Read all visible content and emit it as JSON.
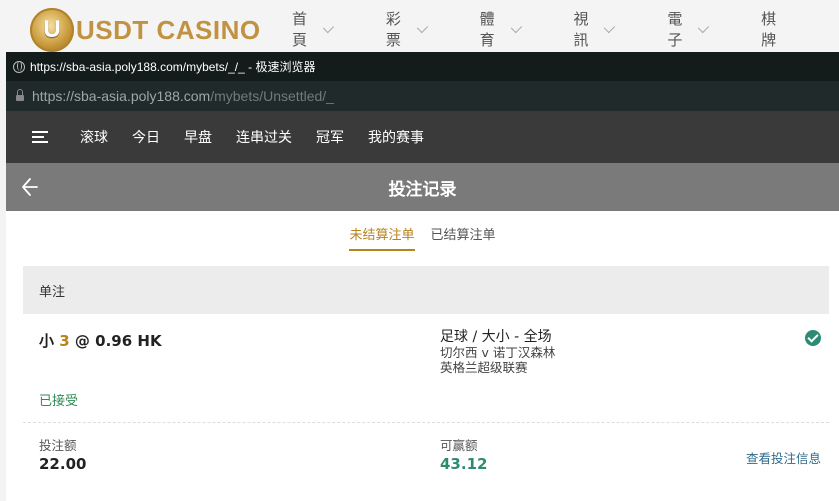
{
  "site": {
    "logo_letter": "U",
    "logo_text": "USDT CASINO",
    "nav": [
      "首頁",
      "彩票",
      "體育",
      "視訊",
      "電子",
      "棋牌"
    ]
  },
  "browser": {
    "title": "https://sba-asia.poly188.com/mybets/_/_ - 极速浏览器",
    "url_base": "https://sba-asia.poly188.com",
    "url_path": "/mybets/Unsettled/_"
  },
  "appnav": {
    "items": [
      "滚球",
      "今日",
      "早盘",
      "连串过关",
      "冠军",
      "我的赛事"
    ]
  },
  "page": {
    "title": "投注记录",
    "tabs": [
      {
        "label": "未结算注单",
        "active": true
      },
      {
        "label": "已结算注单",
        "active": false
      }
    ]
  },
  "bet": {
    "type": "单注",
    "selection": "小",
    "line": "3",
    "at": "@",
    "odds": "0.96 HK",
    "market": "足球 / 大小 - 全场",
    "match": "切尔西 v 诺丁汉森林",
    "league": "英格兰超级联赛",
    "status": "已接受",
    "stake_label": "投注额",
    "stake": "22.00",
    "win_label": "可赢额",
    "win": "43.12",
    "detail_link": "查看投注信息"
  },
  "colors": {
    "accent": "#b8821c",
    "success": "#2e8b73"
  }
}
